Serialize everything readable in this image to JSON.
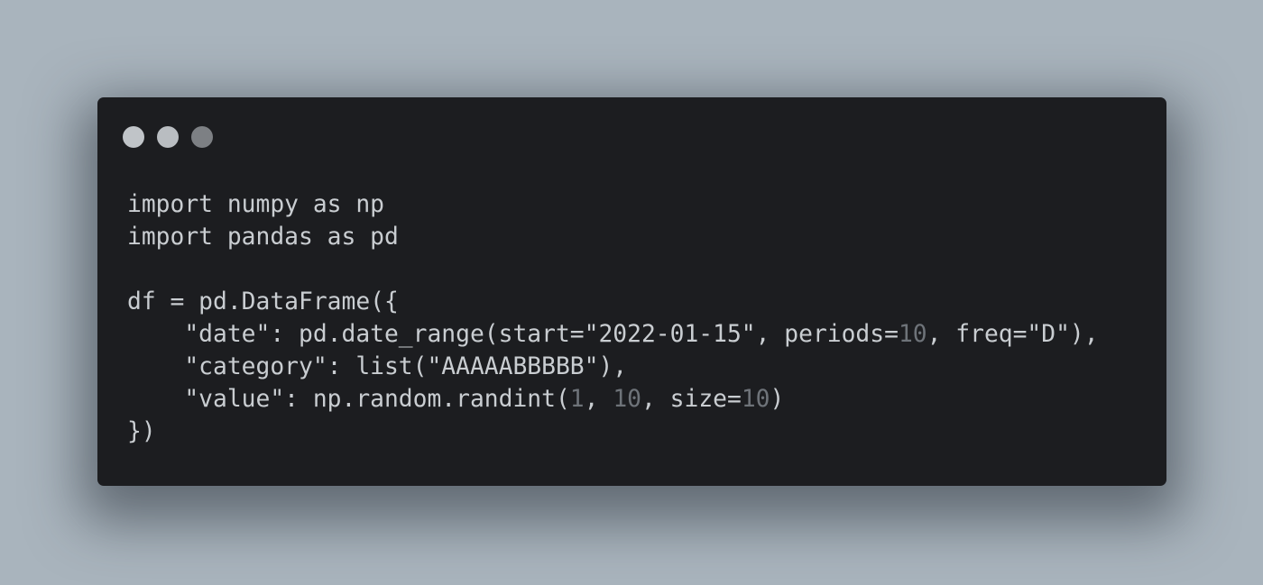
{
  "window_controls": [
    {
      "name": "close-dot-icon",
      "color": "#c0c4c8"
    },
    {
      "name": "minimize-dot-icon",
      "color": "#b9bdc1"
    },
    {
      "name": "zoom-dot-icon",
      "color": "#7d8084"
    }
  ],
  "colors": {
    "background": "#a9b4bd",
    "window": "#1c1d20",
    "text": "#c9cdd1",
    "number": "#6e7379"
  },
  "code": {
    "language": "python",
    "lines": [
      {
        "tokens": [
          {
            "text": "import numpy as np"
          }
        ]
      },
      {
        "tokens": [
          {
            "text": "import pandas as pd"
          }
        ]
      },
      {
        "tokens": []
      },
      {
        "tokens": [
          {
            "text": "df = pd.DataFrame({"
          }
        ]
      },
      {
        "tokens": [
          {
            "text": "    \"date\": pd.date_range(start=\"2022-01-15\", periods="
          },
          {
            "text": "10",
            "type": "number"
          },
          {
            "text": ", freq=\"D\"),"
          }
        ]
      },
      {
        "tokens": [
          {
            "text": "    \"category\": list(\"AAAAABBBBB\"),"
          }
        ]
      },
      {
        "tokens": [
          {
            "text": "    \"value\": np.random.randint("
          },
          {
            "text": "1",
            "type": "number"
          },
          {
            "text": ", "
          },
          {
            "text": "10",
            "type": "number"
          },
          {
            "text": ", size="
          },
          {
            "text": "10",
            "type": "number"
          },
          {
            "text": ")"
          }
        ]
      },
      {
        "tokens": [
          {
            "text": "})"
          }
        ]
      }
    ]
  }
}
